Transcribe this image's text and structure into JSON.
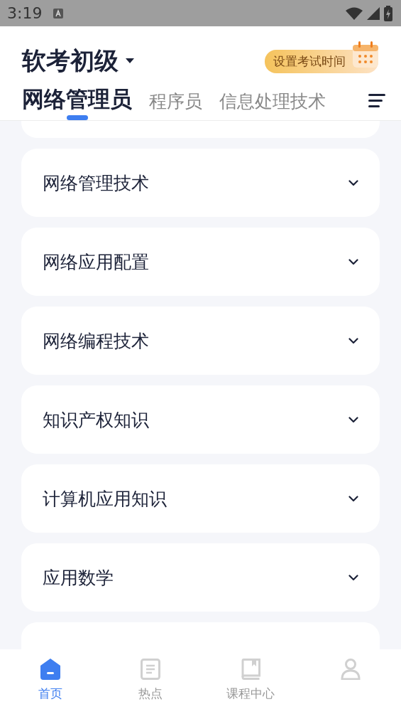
{
  "status_bar": {
    "time": "3:19"
  },
  "header": {
    "exam": "软考初级",
    "set_time_button": "设置考试时间"
  },
  "tabs": [
    {
      "label": "网络管理员",
      "selected": true
    },
    {
      "label": "程序员",
      "selected": false
    },
    {
      "label": "信息处理技术",
      "selected": false
    }
  ],
  "sections": [
    {
      "kind": "partial"
    },
    {
      "kind": "row",
      "title": "网络管理技术",
      "expanded": false
    },
    {
      "kind": "row",
      "title": "网络应用配置",
      "expanded": false
    },
    {
      "kind": "row",
      "title": "网络编程技术",
      "expanded": false
    },
    {
      "kind": "row",
      "title": "知识产权知识",
      "expanded": false
    },
    {
      "kind": "row",
      "title": "计算机应用知识",
      "expanded": false
    },
    {
      "kind": "row",
      "title": "应用数学",
      "expanded": false
    },
    {
      "kind": "partial"
    }
  ],
  "bottom_nav": [
    {
      "kind": "home",
      "label": "首页",
      "selected": true
    },
    {
      "kind": "doc",
      "label": "热点",
      "selected": false
    },
    {
      "kind": "book",
      "label": "课程中心",
      "selected": false
    },
    {
      "kind": "person",
      "selected": false
    }
  ]
}
